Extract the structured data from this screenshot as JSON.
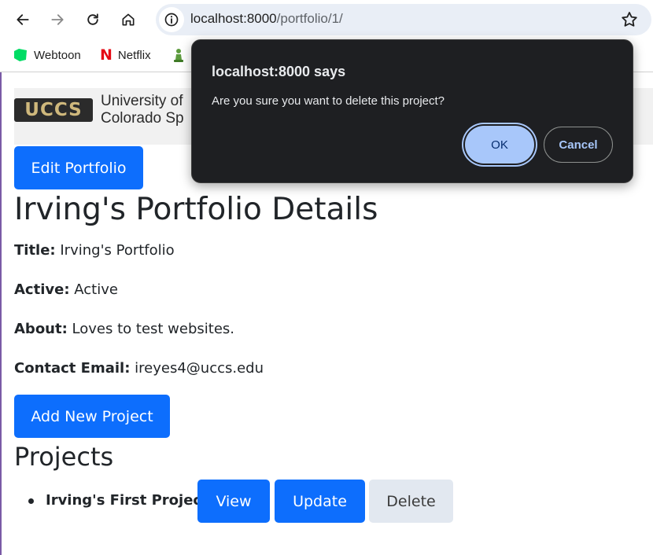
{
  "browser": {
    "url_host": "localhost:8000",
    "url_path": "/portfolio/1/"
  },
  "bookmarks": [
    {
      "label": "Webtoon",
      "icon": "webtoon-icon",
      "color": "#00dc64"
    },
    {
      "label": "Netflix",
      "icon": "netflix-icon",
      "color": "#e50914"
    },
    {
      "label": "",
      "icon": "chess-pawn-icon",
      "color": "#5d9c3e"
    }
  ],
  "banner": {
    "logo_mark": "UCCS",
    "logo_line1": "University of",
    "logo_line2": "Colorado Sp"
  },
  "page": {
    "edit_button": "Edit Portfolio",
    "heading": "Irving's Portfolio Details",
    "fields": [
      {
        "label": "Title:",
        "value": "Irving's Portfolio"
      },
      {
        "label": "Active:",
        "value": "Active"
      },
      {
        "label": "About:",
        "value": "Loves to test websites."
      },
      {
        "label": "Contact Email:",
        "value": "ireyes4@uccs.edu"
      }
    ],
    "add_project_button": "Add New Project",
    "projects_heading": "Projects",
    "projects": [
      {
        "name": "Irving's First Project",
        "view": "View",
        "update": "Update",
        "delete": "Delete"
      }
    ]
  },
  "dialog": {
    "title": "localhost:8000 says",
    "message": "Are you sure you want to delete this project?",
    "ok": "OK",
    "cancel": "Cancel"
  },
  "colors": {
    "primary": "#0d6efd",
    "dialog_bg": "#1e1f22",
    "dialog_ok": "#a8c7fa"
  }
}
